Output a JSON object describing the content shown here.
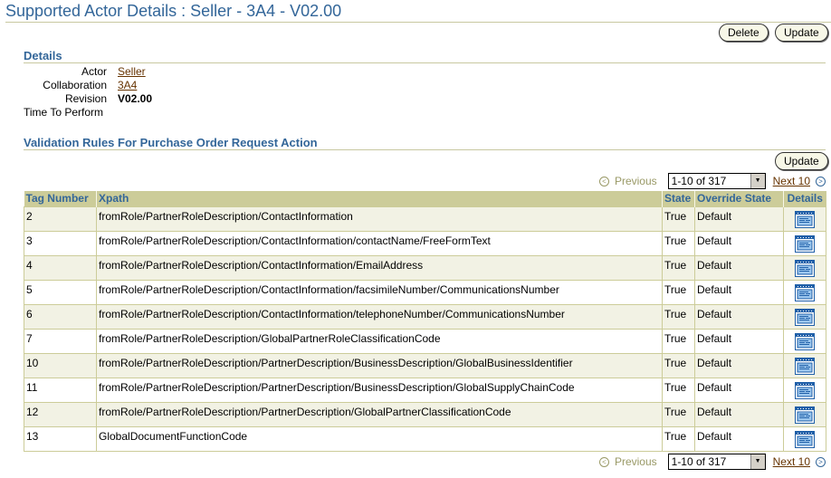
{
  "header": {
    "title": "Supported Actor Details : Seller - 3A4 - V02.00"
  },
  "actions": {
    "delete_label": "Delete",
    "update_label": "Update"
  },
  "details": {
    "title": "Details",
    "actor_label": "Actor",
    "actor_value": "Seller",
    "collaboration_label": "Collaboration",
    "collaboration_value": "3A4",
    "revision_label": "Revision",
    "revision_value": "V02.00",
    "time_label": "Time To Perform",
    "time_value": ""
  },
  "rules": {
    "title": "Validation Rules For Purchase Order Request Action",
    "update_label": "Update",
    "pager": {
      "previous": "Previous",
      "range": "1-10 of 317",
      "next": "Next 10"
    },
    "columns": [
      "Tag Number",
      "Xpath",
      "State",
      "Override State",
      "Details"
    ],
    "rows": [
      {
        "tag": "2",
        "xpath": "fromRole/PartnerRoleDescription/ContactInformation",
        "state": "True",
        "override": "Default"
      },
      {
        "tag": "3",
        "xpath": "fromRole/PartnerRoleDescription/ContactInformation/contactName/FreeFormText",
        "state": "True",
        "override": "Default"
      },
      {
        "tag": "4",
        "xpath": "fromRole/PartnerRoleDescription/ContactInformation/EmailAddress",
        "state": "True",
        "override": "Default"
      },
      {
        "tag": "5",
        "xpath": "fromRole/PartnerRoleDescription/ContactInformation/facsimileNumber/CommunicationsNumber",
        "state": "True",
        "override": "Default"
      },
      {
        "tag": "6",
        "xpath": "fromRole/PartnerRoleDescription/ContactInformation/telephoneNumber/CommunicationsNumber",
        "state": "True",
        "override": "Default"
      },
      {
        "tag": "7",
        "xpath": "fromRole/PartnerRoleDescription/GlobalPartnerRoleClassificationCode",
        "state": "True",
        "override": "Default"
      },
      {
        "tag": "10",
        "xpath": "fromRole/PartnerRoleDescription/PartnerDescription/BusinessDescription/GlobalBusinessIdentifier",
        "state": "True",
        "override": "Default"
      },
      {
        "tag": "11",
        "xpath": "fromRole/PartnerRoleDescription/PartnerDescription/BusinessDescription/GlobalSupplyChainCode",
        "state": "True",
        "override": "Default"
      },
      {
        "tag": "12",
        "xpath": "fromRole/PartnerRoleDescription/PartnerDescription/GlobalPartnerClassificationCode",
        "state": "True",
        "override": "Default"
      },
      {
        "tag": "13",
        "xpath": "GlobalDocumentFunctionCode",
        "state": "True",
        "override": "Default"
      }
    ]
  }
}
